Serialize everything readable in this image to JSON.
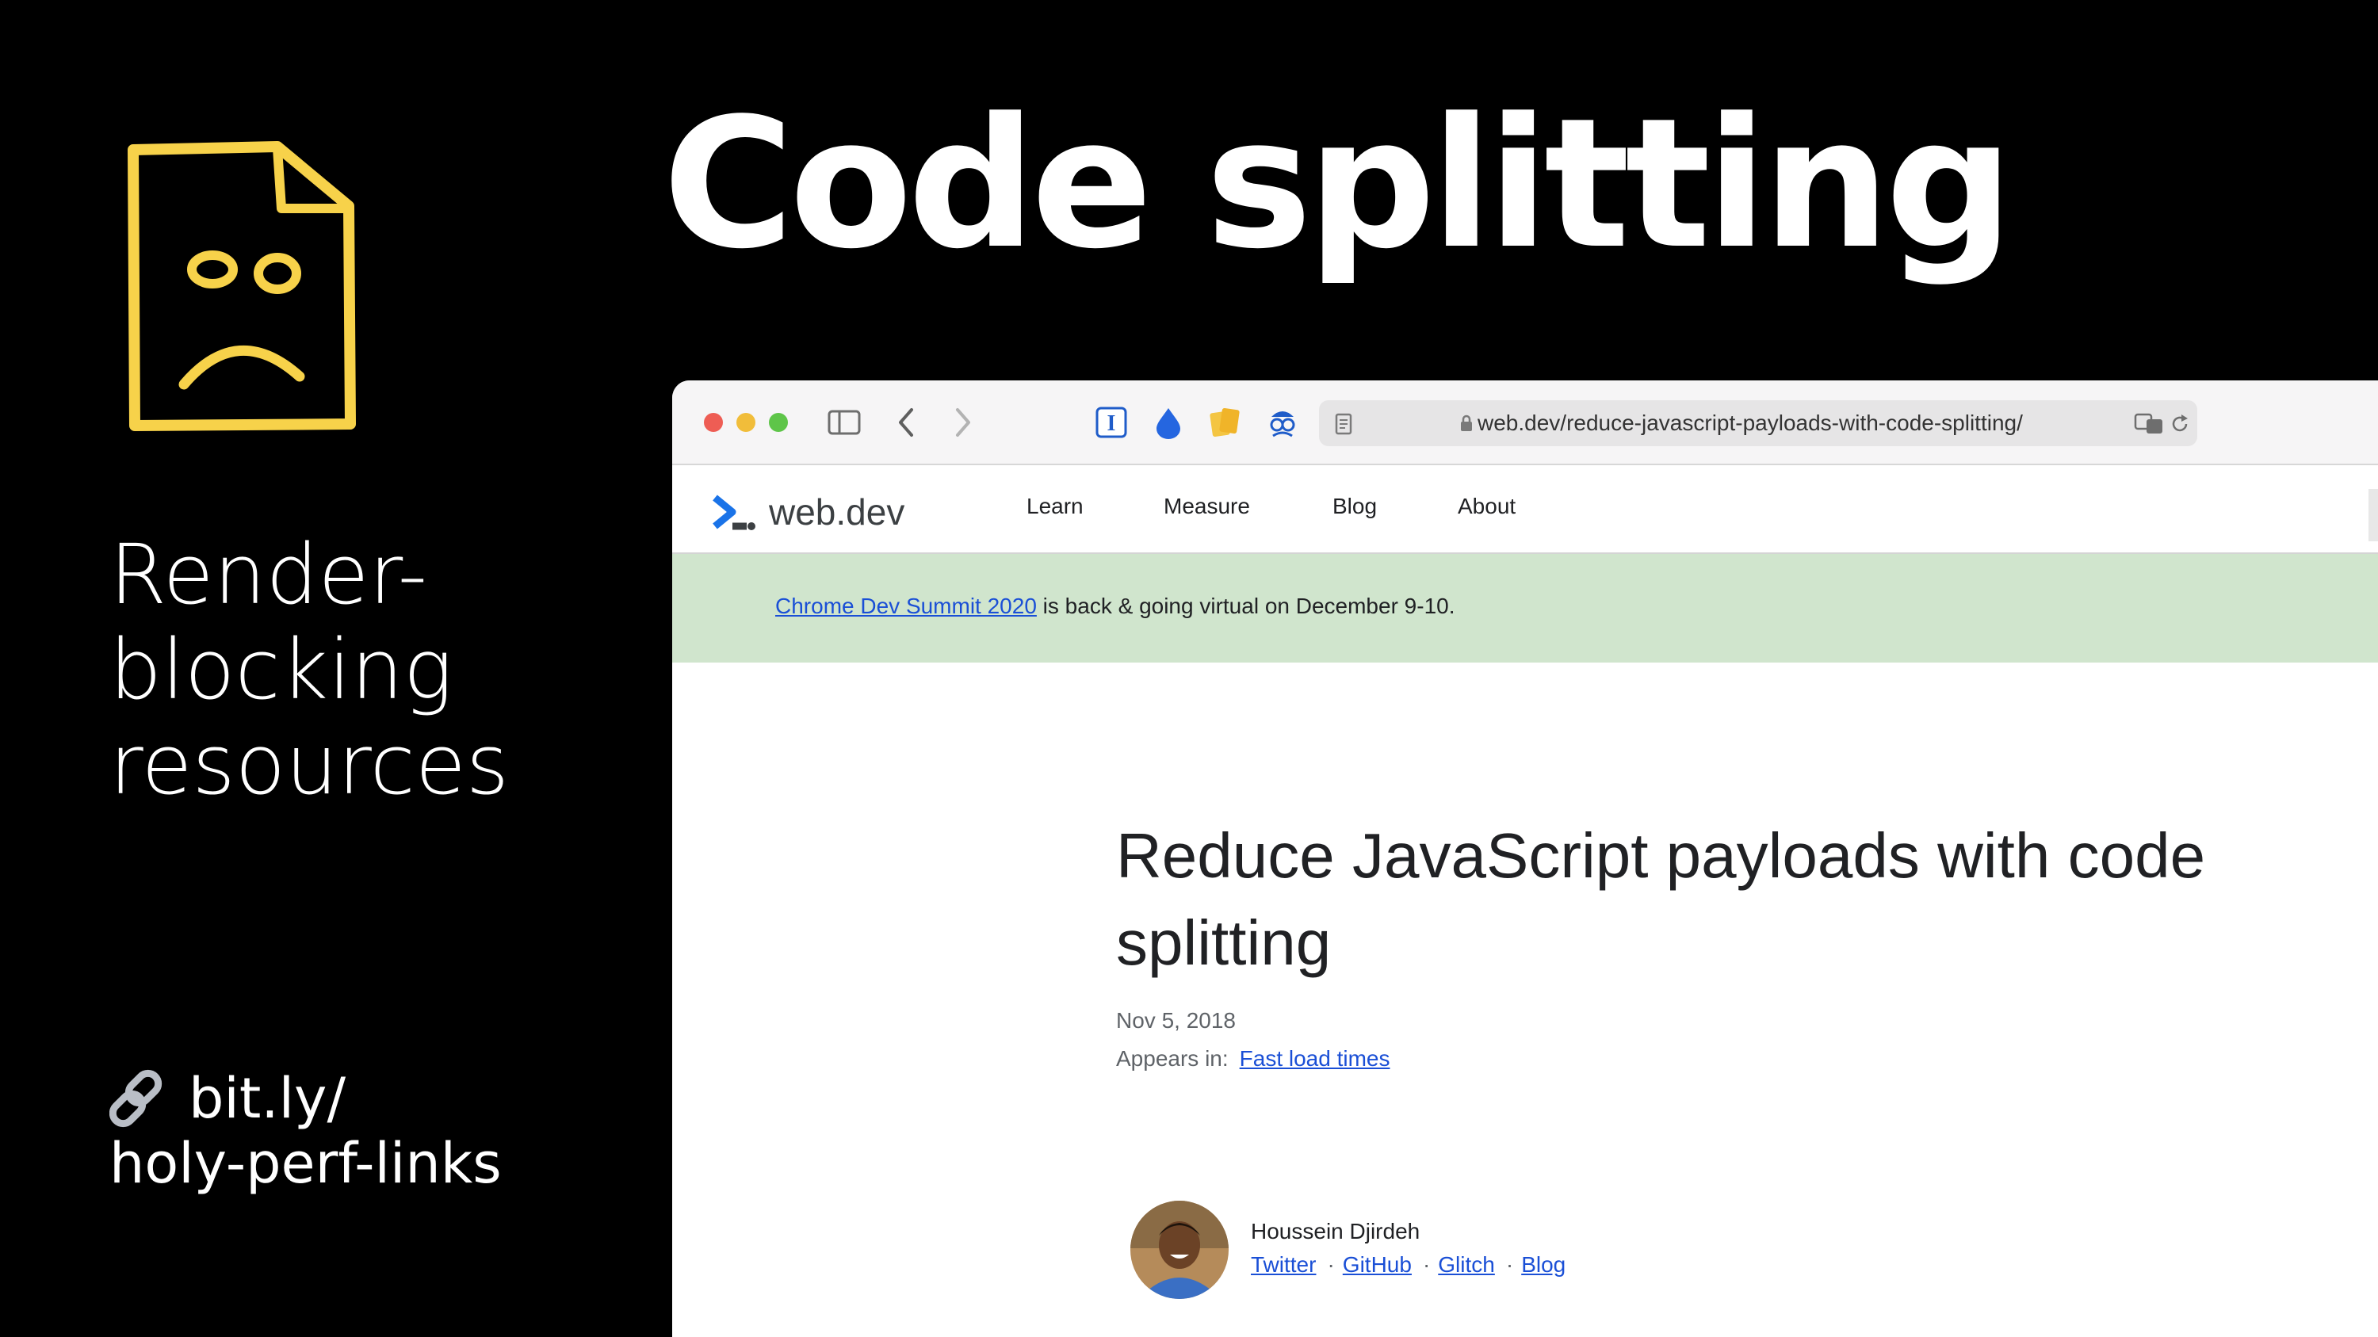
{
  "slide": {
    "title": "Code splitting",
    "side_lines": [
      "Render-",
      "blocking",
      "resources"
    ],
    "link_line1": "bit.ly/",
    "link_line2": "holy-perf-links"
  },
  "colors": {
    "doc_icon": "#f7d24a",
    "accent_link": "#1a4fd6",
    "banner_bg": "#d0e5cd"
  },
  "icons": [
    "sad-document-icon",
    "link-icon",
    "sidebar-toggle-icon",
    "back-icon",
    "forward-icon",
    "instapaper-icon",
    "drop-icon",
    "notes-icon",
    "privacy-icon",
    "reader-icon",
    "lock-icon",
    "translate-icon",
    "reload-icon",
    "webdev-logo-icon"
  ],
  "browser": {
    "url": "web.dev/reduce-javascript-payloads-with-code-splitting/",
    "site_name": "web.dev",
    "nav": [
      "Learn",
      "Measure",
      "Blog",
      "About"
    ],
    "banner": {
      "link_text": "Chrome Dev Summit 2020",
      "text": " is back & going virtual on December 9-10."
    },
    "article": {
      "title": "Reduce JavaScript payloads with code splitting",
      "date": "Nov 5, 2018",
      "appears_label": "Appears in:",
      "appears_link": "Fast load times",
      "author": "Houssein Djirdeh",
      "author_links": [
        "Twitter",
        "GitHub",
        "Glitch",
        "Blog"
      ]
    }
  }
}
